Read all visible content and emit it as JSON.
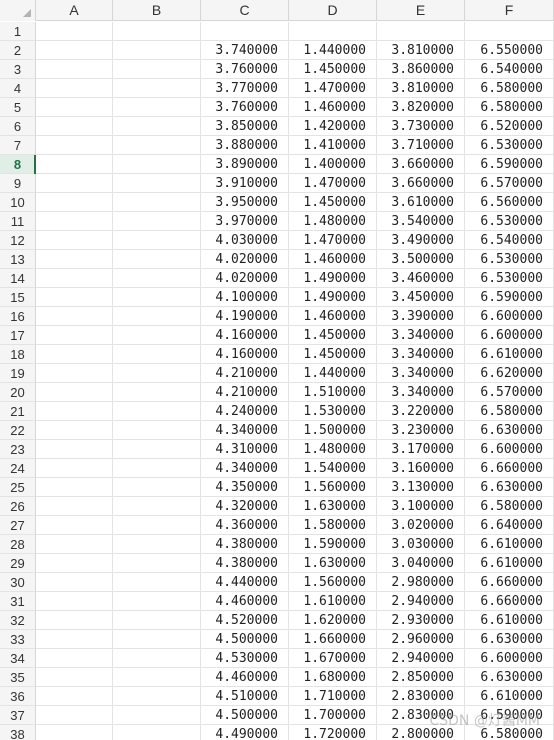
{
  "columns": [
    "A",
    "B",
    "C",
    "D",
    "E",
    "F"
  ],
  "selected_row": 8,
  "rows": [
    {
      "n": "1",
      "c": "",
      "d": "",
      "e": "",
      "f": ""
    },
    {
      "n": "2",
      "c": "3.740000",
      "d": "1.440000",
      "e": "3.810000",
      "f": "6.550000"
    },
    {
      "n": "3",
      "c": "3.760000",
      "d": "1.450000",
      "e": "3.860000",
      "f": "6.540000"
    },
    {
      "n": "4",
      "c": "3.770000",
      "d": "1.470000",
      "e": "3.810000",
      "f": "6.580000"
    },
    {
      "n": "5",
      "c": "3.760000",
      "d": "1.460000",
      "e": "3.820000",
      "f": "6.580000"
    },
    {
      "n": "6",
      "c": "3.850000",
      "d": "1.420000",
      "e": "3.730000",
      "f": "6.520000"
    },
    {
      "n": "7",
      "c": "3.880000",
      "d": "1.410000",
      "e": "3.710000",
      "f": "6.530000"
    },
    {
      "n": "8",
      "c": "3.890000",
      "d": "1.400000",
      "e": "3.660000",
      "f": "6.590000"
    },
    {
      "n": "9",
      "c": "3.910000",
      "d": "1.470000",
      "e": "3.660000",
      "f": "6.570000"
    },
    {
      "n": "10",
      "c": "3.950000",
      "d": "1.450000",
      "e": "3.610000",
      "f": "6.560000"
    },
    {
      "n": "11",
      "c": "3.970000",
      "d": "1.480000",
      "e": "3.540000",
      "f": "6.530000"
    },
    {
      "n": "12",
      "c": "4.030000",
      "d": "1.470000",
      "e": "3.490000",
      "f": "6.540000"
    },
    {
      "n": "13",
      "c": "4.020000",
      "d": "1.460000",
      "e": "3.500000",
      "f": "6.530000"
    },
    {
      "n": "14",
      "c": "4.020000",
      "d": "1.490000",
      "e": "3.460000",
      "f": "6.530000"
    },
    {
      "n": "15",
      "c": "4.100000",
      "d": "1.490000",
      "e": "3.450000",
      "f": "6.590000"
    },
    {
      "n": "16",
      "c": "4.190000",
      "d": "1.460000",
      "e": "3.390000",
      "f": "6.600000"
    },
    {
      "n": "17",
      "c": "4.160000",
      "d": "1.450000",
      "e": "3.340000",
      "f": "6.600000"
    },
    {
      "n": "18",
      "c": "4.160000",
      "d": "1.450000",
      "e": "3.340000",
      "f": "6.610000"
    },
    {
      "n": "19",
      "c": "4.210000",
      "d": "1.440000",
      "e": "3.340000",
      "f": "6.620000"
    },
    {
      "n": "20",
      "c": "4.210000",
      "d": "1.510000",
      "e": "3.340000",
      "f": "6.570000"
    },
    {
      "n": "21",
      "c": "4.240000",
      "d": "1.530000",
      "e": "3.220000",
      "f": "6.580000"
    },
    {
      "n": "22",
      "c": "4.340000",
      "d": "1.500000",
      "e": "3.230000",
      "f": "6.630000"
    },
    {
      "n": "23",
      "c": "4.310000",
      "d": "1.480000",
      "e": "3.170000",
      "f": "6.600000"
    },
    {
      "n": "24",
      "c": "4.340000",
      "d": "1.540000",
      "e": "3.160000",
      "f": "6.660000"
    },
    {
      "n": "25",
      "c": "4.350000",
      "d": "1.560000",
      "e": "3.130000",
      "f": "6.630000"
    },
    {
      "n": "26",
      "c": "4.320000",
      "d": "1.630000",
      "e": "3.100000",
      "f": "6.580000"
    },
    {
      "n": "27",
      "c": "4.360000",
      "d": "1.580000",
      "e": "3.020000",
      "f": "6.640000"
    },
    {
      "n": "28",
      "c": "4.380000",
      "d": "1.590000",
      "e": "3.030000",
      "f": "6.610000"
    },
    {
      "n": "29",
      "c": "4.380000",
      "d": "1.630000",
      "e": "3.040000",
      "f": "6.610000"
    },
    {
      "n": "30",
      "c": "4.440000",
      "d": "1.560000",
      "e": "2.980000",
      "f": "6.660000"
    },
    {
      "n": "31",
      "c": "4.460000",
      "d": "1.610000",
      "e": "2.940000",
      "f": "6.660000"
    },
    {
      "n": "32",
      "c": "4.520000",
      "d": "1.620000",
      "e": "2.930000",
      "f": "6.610000"
    },
    {
      "n": "33",
      "c": "4.500000",
      "d": "1.660000",
      "e": "2.960000",
      "f": "6.630000"
    },
    {
      "n": "34",
      "c": "4.530000",
      "d": "1.670000",
      "e": "2.940000",
      "f": "6.600000"
    },
    {
      "n": "35",
      "c": "4.460000",
      "d": "1.680000",
      "e": "2.850000",
      "f": "6.630000"
    },
    {
      "n": "36",
      "c": "4.510000",
      "d": "1.710000",
      "e": "2.830000",
      "f": "6.610000"
    },
    {
      "n": "37",
      "c": "4.500000",
      "d": "1.700000",
      "e": "2.830000",
      "f": "6.590000"
    },
    {
      "n": "38",
      "c": "4.490000",
      "d": "1.720000",
      "e": "2.800000",
      "f": "6.580000"
    }
  ],
  "watermark": "CSDN @灯酱MM"
}
